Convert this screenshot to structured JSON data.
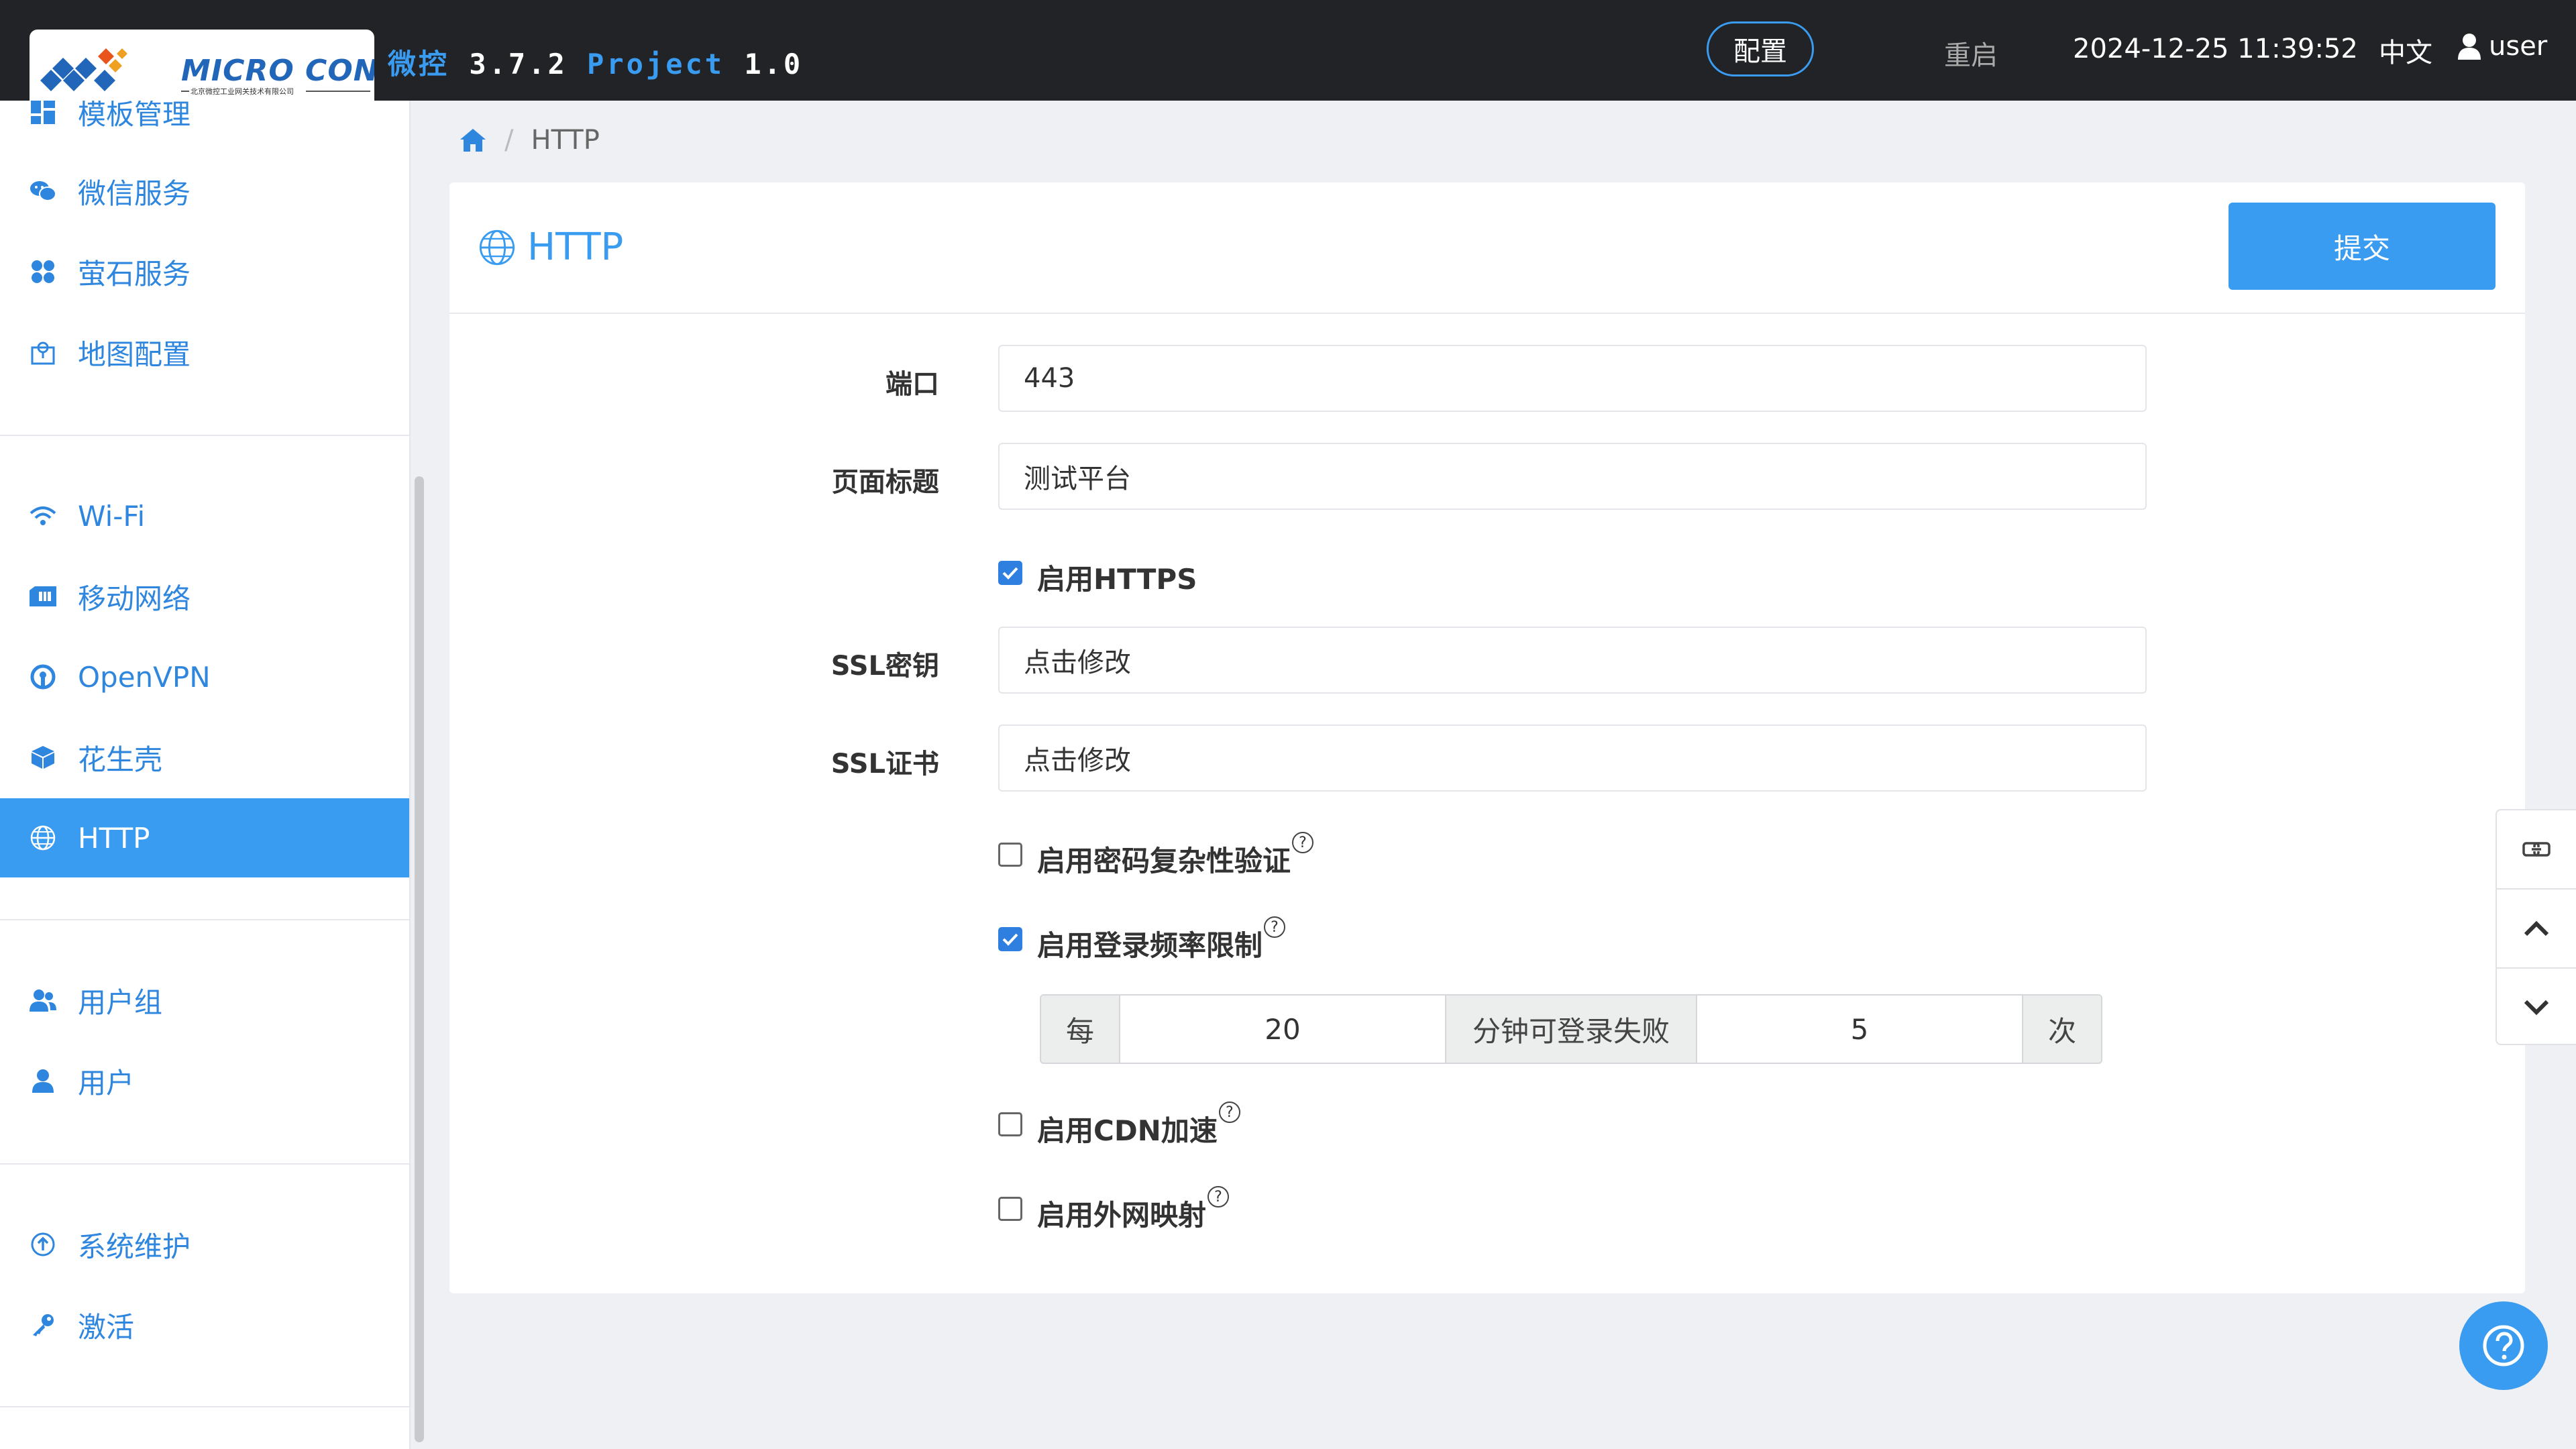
{
  "header": {
    "logo_text": "MICRO CONTROL",
    "logo_subtext": "北京微控工业网关技术有限公司",
    "app_name": "微控",
    "app_version": "3.7.2",
    "project_label": "Project",
    "project_version": "1.0",
    "config_label": "配置",
    "restart_label": "重启",
    "datetime": "2024-12-25 11:39:52",
    "language": "中文",
    "username": "user"
  },
  "sidebar": {
    "items": [
      {
        "label": "模板管理",
        "icon": "grid-icon"
      },
      {
        "label": "微信服务",
        "icon": "wechat-icon"
      },
      {
        "label": "萤石服务",
        "icon": "fan-icon"
      },
      {
        "label": "地图配置",
        "icon": "map-icon"
      },
      {
        "label": "Wi-Fi",
        "icon": "wifi-icon"
      },
      {
        "label": "移动网络",
        "icon": "sim-card-icon"
      },
      {
        "label": "OpenVPN",
        "icon": "openvpn-icon"
      },
      {
        "label": "花生壳",
        "icon": "cube-icon"
      },
      {
        "label": "HTTP",
        "icon": "globe-icon",
        "active": true
      },
      {
        "label": "用户组",
        "icon": "users-icon"
      },
      {
        "label": "用户",
        "icon": "user-icon"
      },
      {
        "label": "系统维护",
        "icon": "upload-circle-icon"
      },
      {
        "label": "激活",
        "icon": "key-icon"
      }
    ]
  },
  "breadcrumb": {
    "home_icon": "home-icon",
    "current": "HTTP"
  },
  "panel": {
    "title": "HTTP",
    "submit_label": "提交"
  },
  "form": {
    "port_label": "端口",
    "port_value": "443",
    "page_title_label": "页面标题",
    "page_title_value": "测试平台",
    "https_label": "启用HTTPS",
    "https_checked": true,
    "ssl_key_label": "SSL密钥",
    "ssl_key_value": "点击修改",
    "ssl_cert_label": "SSL证书",
    "ssl_cert_value": "点击修改",
    "pwd_complexity_label": "启用密码复杂性验证",
    "pwd_complexity_checked": false,
    "login_rate_label": "启用登录频率限制",
    "login_rate_checked": true,
    "rate_prefix": "每",
    "rate_minutes": "20",
    "rate_middle": "分钟可登录失败",
    "rate_count": "5",
    "rate_suffix": "次",
    "cdn_label": "启用CDN加速",
    "cdn_checked": false,
    "external_map_label": "启用外网映射",
    "external_map_checked": false,
    "help_glyph": "?"
  },
  "colors": {
    "accent": "#3a9cf0",
    "topbar": "#222326",
    "sidebar_text": "#2e86de"
  }
}
